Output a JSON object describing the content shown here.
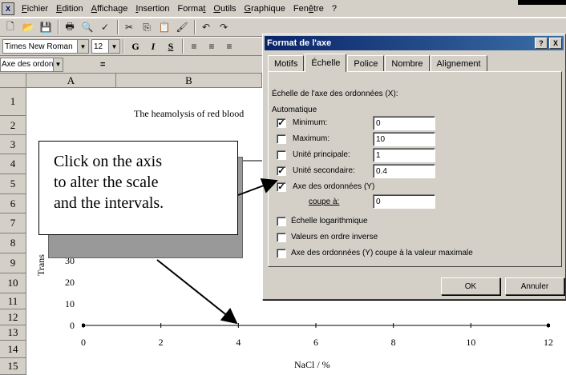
{
  "menu": {
    "items": [
      "Fichier",
      "Edition",
      "Affichage",
      "Insertion",
      "Format",
      "Outils",
      "Graphique",
      "Fenêtre",
      "?"
    ]
  },
  "toolbar_format": {
    "font": "Times New Roman",
    "size": "12",
    "bold": "G",
    "italic": "I",
    "underline": "S"
  },
  "formula_bar": {
    "name_box": "Axe des ordonnées...",
    "equals": "="
  },
  "sheet": {
    "columns": [
      "A",
      "B"
    ],
    "rows": [
      "1",
      "2",
      "3",
      "4",
      "5",
      "6",
      "7",
      "8",
      "9",
      "10",
      "11",
      "12",
      "13",
      "14",
      "15"
    ]
  },
  "chart_data": {
    "type": "line",
    "title": "The heamolysis of red blood",
    "xlabel": "NaCl / %",
    "ylabel": "Trans",
    "x_ticks": [
      "0",
      "2",
      "4",
      "6",
      "8",
      "10",
      "12"
    ],
    "y_ticks": [
      "0",
      "10",
      "20",
      "30"
    ],
    "xlim": [
      0,
      12
    ],
    "ylim": [
      0,
      35
    ]
  },
  "callout": {
    "line1": "Click on the axis",
    "line2": "to alter the scale",
    "line3": "and the intervals."
  },
  "dialog": {
    "title": "Format de l'axe",
    "help": "?",
    "close": "X",
    "tabs": [
      "Motifs",
      "Échelle",
      "Police",
      "Nombre",
      "Alignement"
    ],
    "heading": "Échelle de l'axe des ordonnées (X):",
    "auto": "Automatique",
    "minimum_label": "Minimum:",
    "minimum_value": "0",
    "maximum_label": "Maximum:",
    "maximum_value": "10",
    "major_label": "Unité principale:",
    "major_value": "1",
    "minor_label": "Unité secondaire:",
    "minor_value": "0.4",
    "cross_label": "Axe des ordonnées (Y)",
    "cross_at_label": "coupe à:",
    "cross_at_value": "0",
    "log_label": "Échelle logarithmique",
    "reverse_label": "Valeurs en ordre inverse",
    "cross_max_label": "Axe des ordonnées (Y) coupe à la valeur maximale",
    "ok": "OK",
    "cancel": "Annuler"
  }
}
